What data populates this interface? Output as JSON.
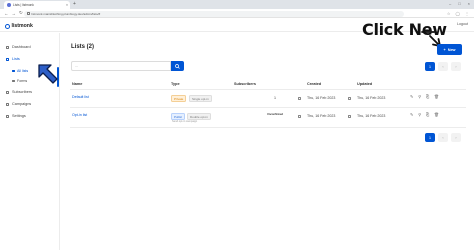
{
  "browser": {
    "tab_title": "Lists | listmonk",
    "tab_close": "×",
    "new_tab": "+",
    "window_controls": [
      "–",
      "□",
      "×"
    ],
    "nav": [
      "←",
      "→",
      "↻"
    ],
    "url": "listmonk.manishkothing.plumbiogy.dev/admin/lists/#"
  },
  "app": {
    "logo_text": "listmonk",
    "logout": "Logout"
  },
  "sidebar": {
    "items": [
      {
        "label": "Dashboard",
        "icon": "dashboard-icon"
      },
      {
        "label": "Lists",
        "icon": "lists-icon"
      },
      {
        "label": "All lists",
        "icon": "all-lists-icon"
      },
      {
        "label": "Forms",
        "icon": "forms-icon"
      },
      {
        "label": "Subscribers",
        "icon": "subscribers-icon"
      },
      {
        "label": "Campaigns",
        "icon": "campaigns-icon"
      },
      {
        "label": "Settings",
        "icon": "settings-icon"
      }
    ]
  },
  "annotation": {
    "callout": "Click New",
    "color": "#0055d4"
  },
  "main": {
    "title": "Lists (2)",
    "new_button": "New",
    "new_button_plus": "+",
    "search_placeholder": "...",
    "pagination": {
      "current": "1",
      "prev": "‹",
      "next": "›"
    },
    "columns": [
      "Name",
      "Type",
      "Subscribers",
      "Created",
      "Updated"
    ],
    "rows": [
      {
        "name": "Default list",
        "type_tag": "Private",
        "optin_tag": "Single opt-in",
        "subscribers": "1",
        "subscriber_status": "",
        "created": "Thu, 16 Feb 2023",
        "updated": "Thu, 16 Feb 2023",
        "note": ""
      },
      {
        "name": "Opt-in list",
        "type_tag": "Public",
        "optin_tag": "Double opt-in",
        "subscribers": "",
        "subscriber_status": "Unconfirmed",
        "created": "Thu, 16 Feb 2023",
        "updated": "Thu, 16 Feb 2023",
        "note": "Send opt-in campaign"
      }
    ],
    "row_actions": [
      "✎",
      "⚲",
      "⎘",
      "🗑"
    ]
  },
  "colors": {
    "accent": "#0055d4",
    "private_tag": "#d8840b",
    "public_tag": "#2f6fd6"
  }
}
